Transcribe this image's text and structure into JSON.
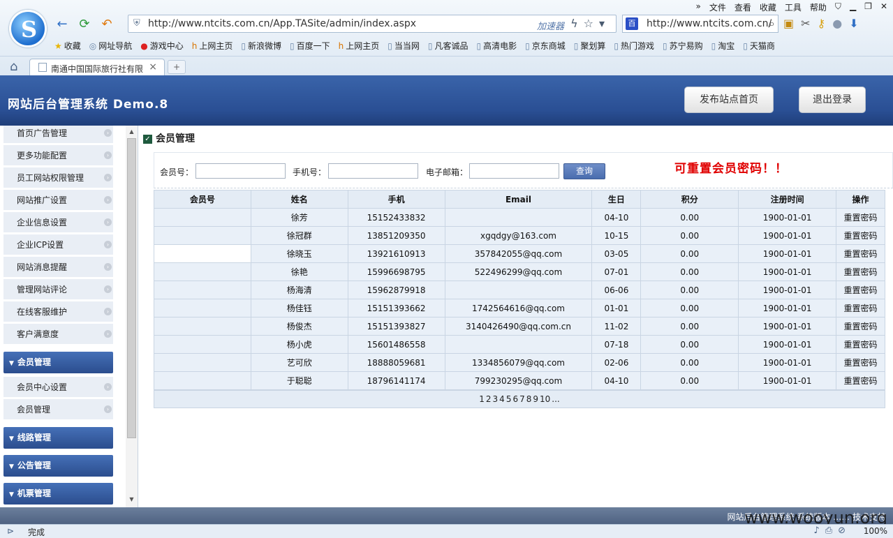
{
  "browser": {
    "top_menu": [
      "»",
      "文件",
      "查看",
      "收藏",
      "工具",
      "帮助"
    ],
    "url": "http://www.ntcits.com.cn/App.TASite/admin/index.aspx",
    "accelerator_label": "加速器",
    "search_text": "http://www.ntcits.com.cn/",
    "bookmarks": [
      "收藏",
      "网址导航",
      "游戏中心",
      "上网主页",
      "新浪微博",
      "百度一下",
      "上网主页",
      "当当网",
      "凡客诚品",
      "高清电影",
      "京东商城",
      "聚划算",
      "热门游戏",
      "苏宁易购",
      "淘宝",
      "天猫商"
    ],
    "tab_title": "南通中国国际旅行社有限",
    "status": "完成",
    "zoom": "100%"
  },
  "header": {
    "title": "网站后台管理系统  Demo.8",
    "publish_label": "发布站点首页",
    "logout_label": "退出登录"
  },
  "sidebar": {
    "items_top": [
      "首页广告管理",
      "更多功能配置",
      "员工网站权限管理",
      "网站推广设置",
      "企业信息设置",
      "企业ICP设置",
      "网站消息提醒",
      "管理网站评论",
      "在线客服维护",
      "客户满意度"
    ],
    "member_group": "会员管理",
    "member_items": [
      "会员中心设置",
      "会员管理"
    ],
    "route_group": "线路管理",
    "notice_group": "公告管理",
    "ticket_group": "机票管理"
  },
  "main": {
    "section_title": "会员管理",
    "notice": "可重置会员密码！！",
    "filters": {
      "member_no_label": "会员号：",
      "phone_label": "手机号：",
      "email_label": "电子邮箱：",
      "member_no_value": "",
      "phone_value": "",
      "email_value": "",
      "query_label": "查询"
    },
    "columns": [
      "会员号",
      "姓名",
      "手机",
      "Email",
      "生日",
      "积分",
      "注册时间",
      "操作"
    ],
    "rows": [
      {
        "id": "",
        "name": "徐芳",
        "phone": "15152433832",
        "email": "",
        "birthday": "04-10",
        "points": "0.00",
        "registered": "1900-01-01",
        "action": "重置密码"
      },
      {
        "id": "",
        "name": "徐冠群",
        "phone": "13851209350",
        "email": "xgqdgy@163.com",
        "birthday": "10-15",
        "points": "0.00",
        "registered": "1900-01-01",
        "action": "重置密码"
      },
      {
        "id": "",
        "name": "徐晓玉",
        "phone": "13921610913",
        "email": "357842055@qq.com",
        "birthday": "03-05",
        "points": "0.00",
        "registered": "1900-01-01",
        "action": "重置密码"
      },
      {
        "id": "",
        "name": "徐艳",
        "phone": "15996698795",
        "email": "522496299@qq.com",
        "birthday": "07-01",
        "points": "0.00",
        "registered": "1900-01-01",
        "action": "重置密码"
      },
      {
        "id": "",
        "name": "杨海清",
        "phone": "15962879918",
        "email": "",
        "birthday": "06-06",
        "points": "0.00",
        "registered": "1900-01-01",
        "action": "重置密码"
      },
      {
        "id": "",
        "name": "杨佳钰",
        "phone": "15151393662",
        "email": "1742564616@qq.com",
        "birthday": "01-01",
        "points": "0.00",
        "registered": "1900-01-01",
        "action": "重置密码"
      },
      {
        "id": "",
        "name": "杨俊杰",
        "phone": "15151393827",
        "email": "3140426490@qq.com.cn",
        "birthday": "11-02",
        "points": "0.00",
        "registered": "1900-01-01",
        "action": "重置密码"
      },
      {
        "id": "",
        "name": "杨小虎",
        "phone": "15601486558",
        "email": "",
        "birthday": "07-18",
        "points": "0.00",
        "registered": "1900-01-01",
        "action": "重置密码"
      },
      {
        "id": "",
        "name": "艺可欣",
        "phone": "18888059681",
        "email": "1334856079@qq.com",
        "birthday": "02-06",
        "points": "0.00",
        "registered": "1900-01-01",
        "action": "重置密码"
      },
      {
        "id": "",
        "name": "于聪聪",
        "phone": "18796141174",
        "email": "799230295@qq.com",
        "birthday": "04-10",
        "points": "0.00",
        "registered": "1900-01-01",
        "action": "重置密码"
      }
    ],
    "pages": [
      "1",
      "2",
      "3",
      "4",
      "5",
      "6",
      "7",
      "8",
      "9",
      "10",
      "..."
    ]
  },
  "footer": {
    "text": "网站后台管理系统  系统版本 ……  技术支持"
  },
  "watermark": "www.wooyun.org",
  "colors": {
    "header_blue": "#2a4f94",
    "notice_red": "#e00000",
    "table_row": "#e9f0f8"
  }
}
